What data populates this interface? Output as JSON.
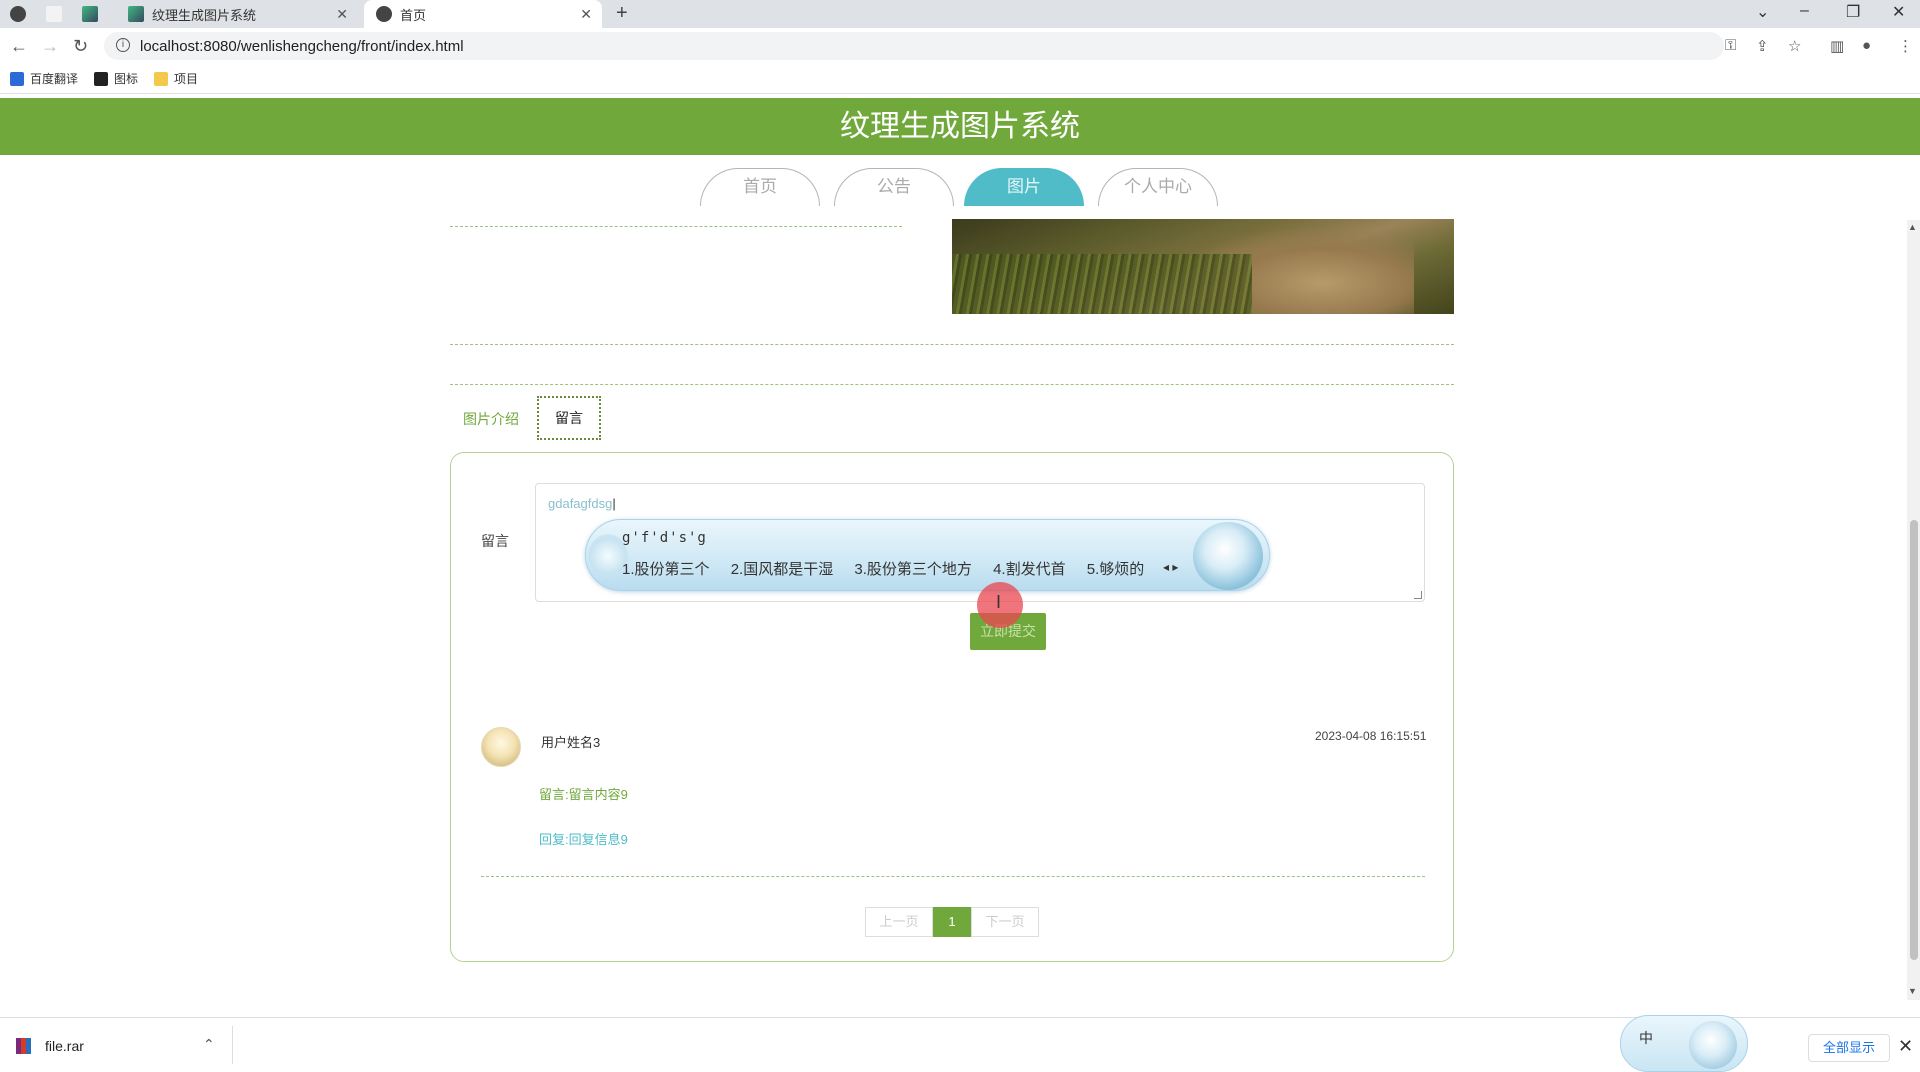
{
  "browser": {
    "tabs": [
      {
        "label": ""
      },
      {
        "label": ""
      },
      {
        "label": ""
      },
      {
        "label": "纹理生成图片系统",
        "close": "✕"
      },
      {
        "label": "首页",
        "close": "✕"
      }
    ],
    "new_tab": "+",
    "url": "localhost:8080/wenlishengcheng/front/index.html",
    "bookmarks": [
      {
        "label": "百度翻译",
        "color": "#2b6bd8"
      },
      {
        "label": "图标",
        "color": "#222222"
      },
      {
        "label": "项目",
        "color": "#f2c94c"
      }
    ]
  },
  "site": {
    "title": "纹理生成图片系统",
    "brand_color": "#71a83c",
    "accent_color": "#4fbcc8",
    "nav": [
      {
        "label": "首页",
        "active": false
      },
      {
        "label": "公告",
        "active": false
      },
      {
        "label": "图片",
        "active": true
      },
      {
        "label": "个人中心",
        "active": false
      }
    ]
  },
  "detail": {
    "tabs": [
      {
        "label": "图片介绍",
        "active": false
      },
      {
        "label": "留言",
        "active": true
      }
    ],
    "form": {
      "label": "留言",
      "value": "gdafagfdsg",
      "submit_label": "立即提交"
    },
    "ime": {
      "composition": "g'f'd's'g",
      "candidates": [
        "1.股份第三个",
        "2.国风都是干湿",
        "3.股份第三个地方",
        "4.割发代首",
        "5.够烦的"
      ],
      "arrows": "◂ ▸"
    },
    "comments": [
      {
        "user": "用户姓名3",
        "time": "2023-04-08 16:15:51",
        "message": "留言:留言内容9",
        "reply": "回复:回复信息9"
      }
    ],
    "pagination": {
      "prev": "上一页",
      "current": "1",
      "next": "下一页"
    }
  },
  "downloads": {
    "file": "file.rar",
    "show_all": "全部显示",
    "ime_indicator": "中"
  }
}
